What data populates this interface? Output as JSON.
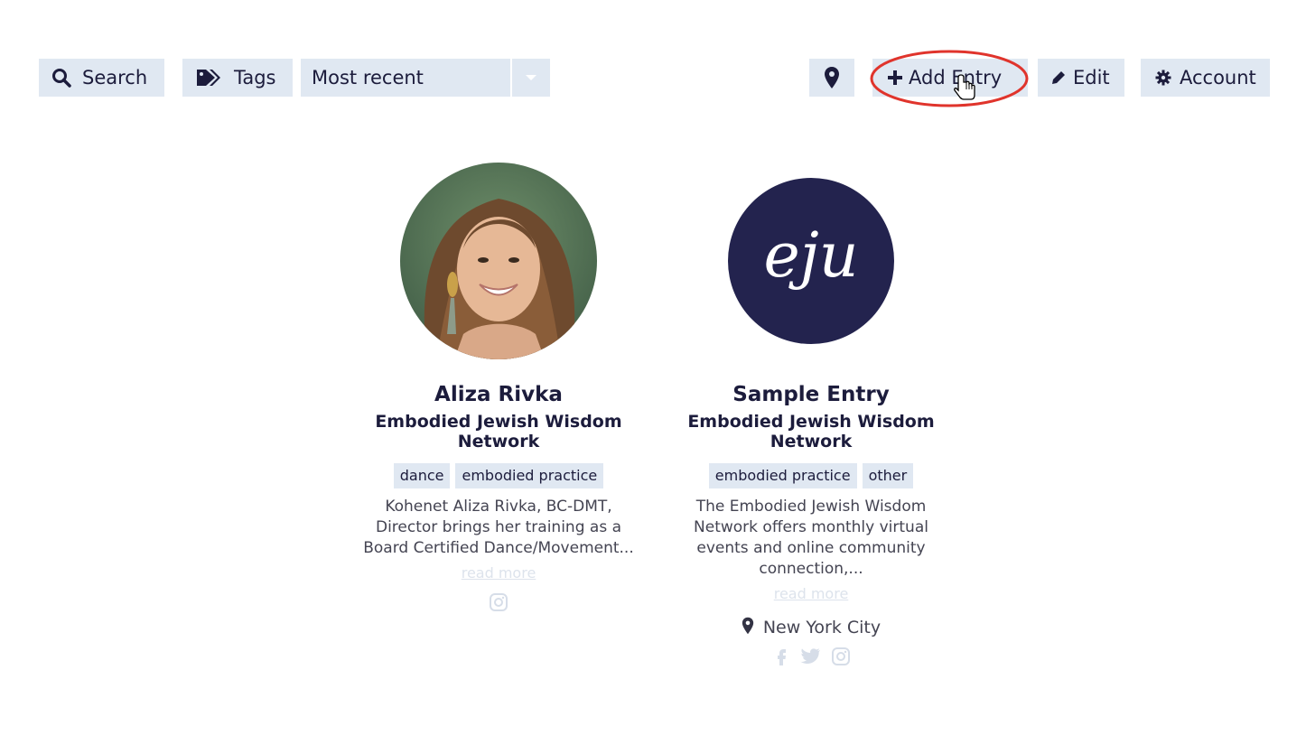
{
  "toolbar": {
    "search_label": "Search",
    "tags_label": "Tags",
    "sort_selected": "Most recent",
    "add_label": "Add Entry",
    "edit_label": "Edit",
    "account_label": "Account"
  },
  "colors": {
    "button_bg": "#e0e8f2",
    "text_dark": "#1c1c3c",
    "annotation_red": "#e0342c",
    "logo_navy": "#23234e"
  },
  "entries": [
    {
      "name": "Aliza Rivka",
      "org": "Embodied Jewish Wisdom Network",
      "tags": [
        "dance",
        "embodied practice"
      ],
      "description": "Kohenet Aliza Rivka, BC-DMT, Director brings her training as a Board Certified Dance/Movement...",
      "read_more": "read more",
      "social_icons": [
        "instagram-icon"
      ]
    },
    {
      "name": "Sample Entry",
      "org": "Embodied Jewish Wisdom Network",
      "tags": [
        "embodied practice",
        "other"
      ],
      "description": "The Embodied Jewish Wisdom Network offers monthly virtual events and online community connection,...",
      "read_more": "read more",
      "location": "New York City",
      "logo_text": "eju",
      "social_icons": [
        "facebook-icon",
        "twitter-icon",
        "instagram-icon"
      ]
    }
  ]
}
